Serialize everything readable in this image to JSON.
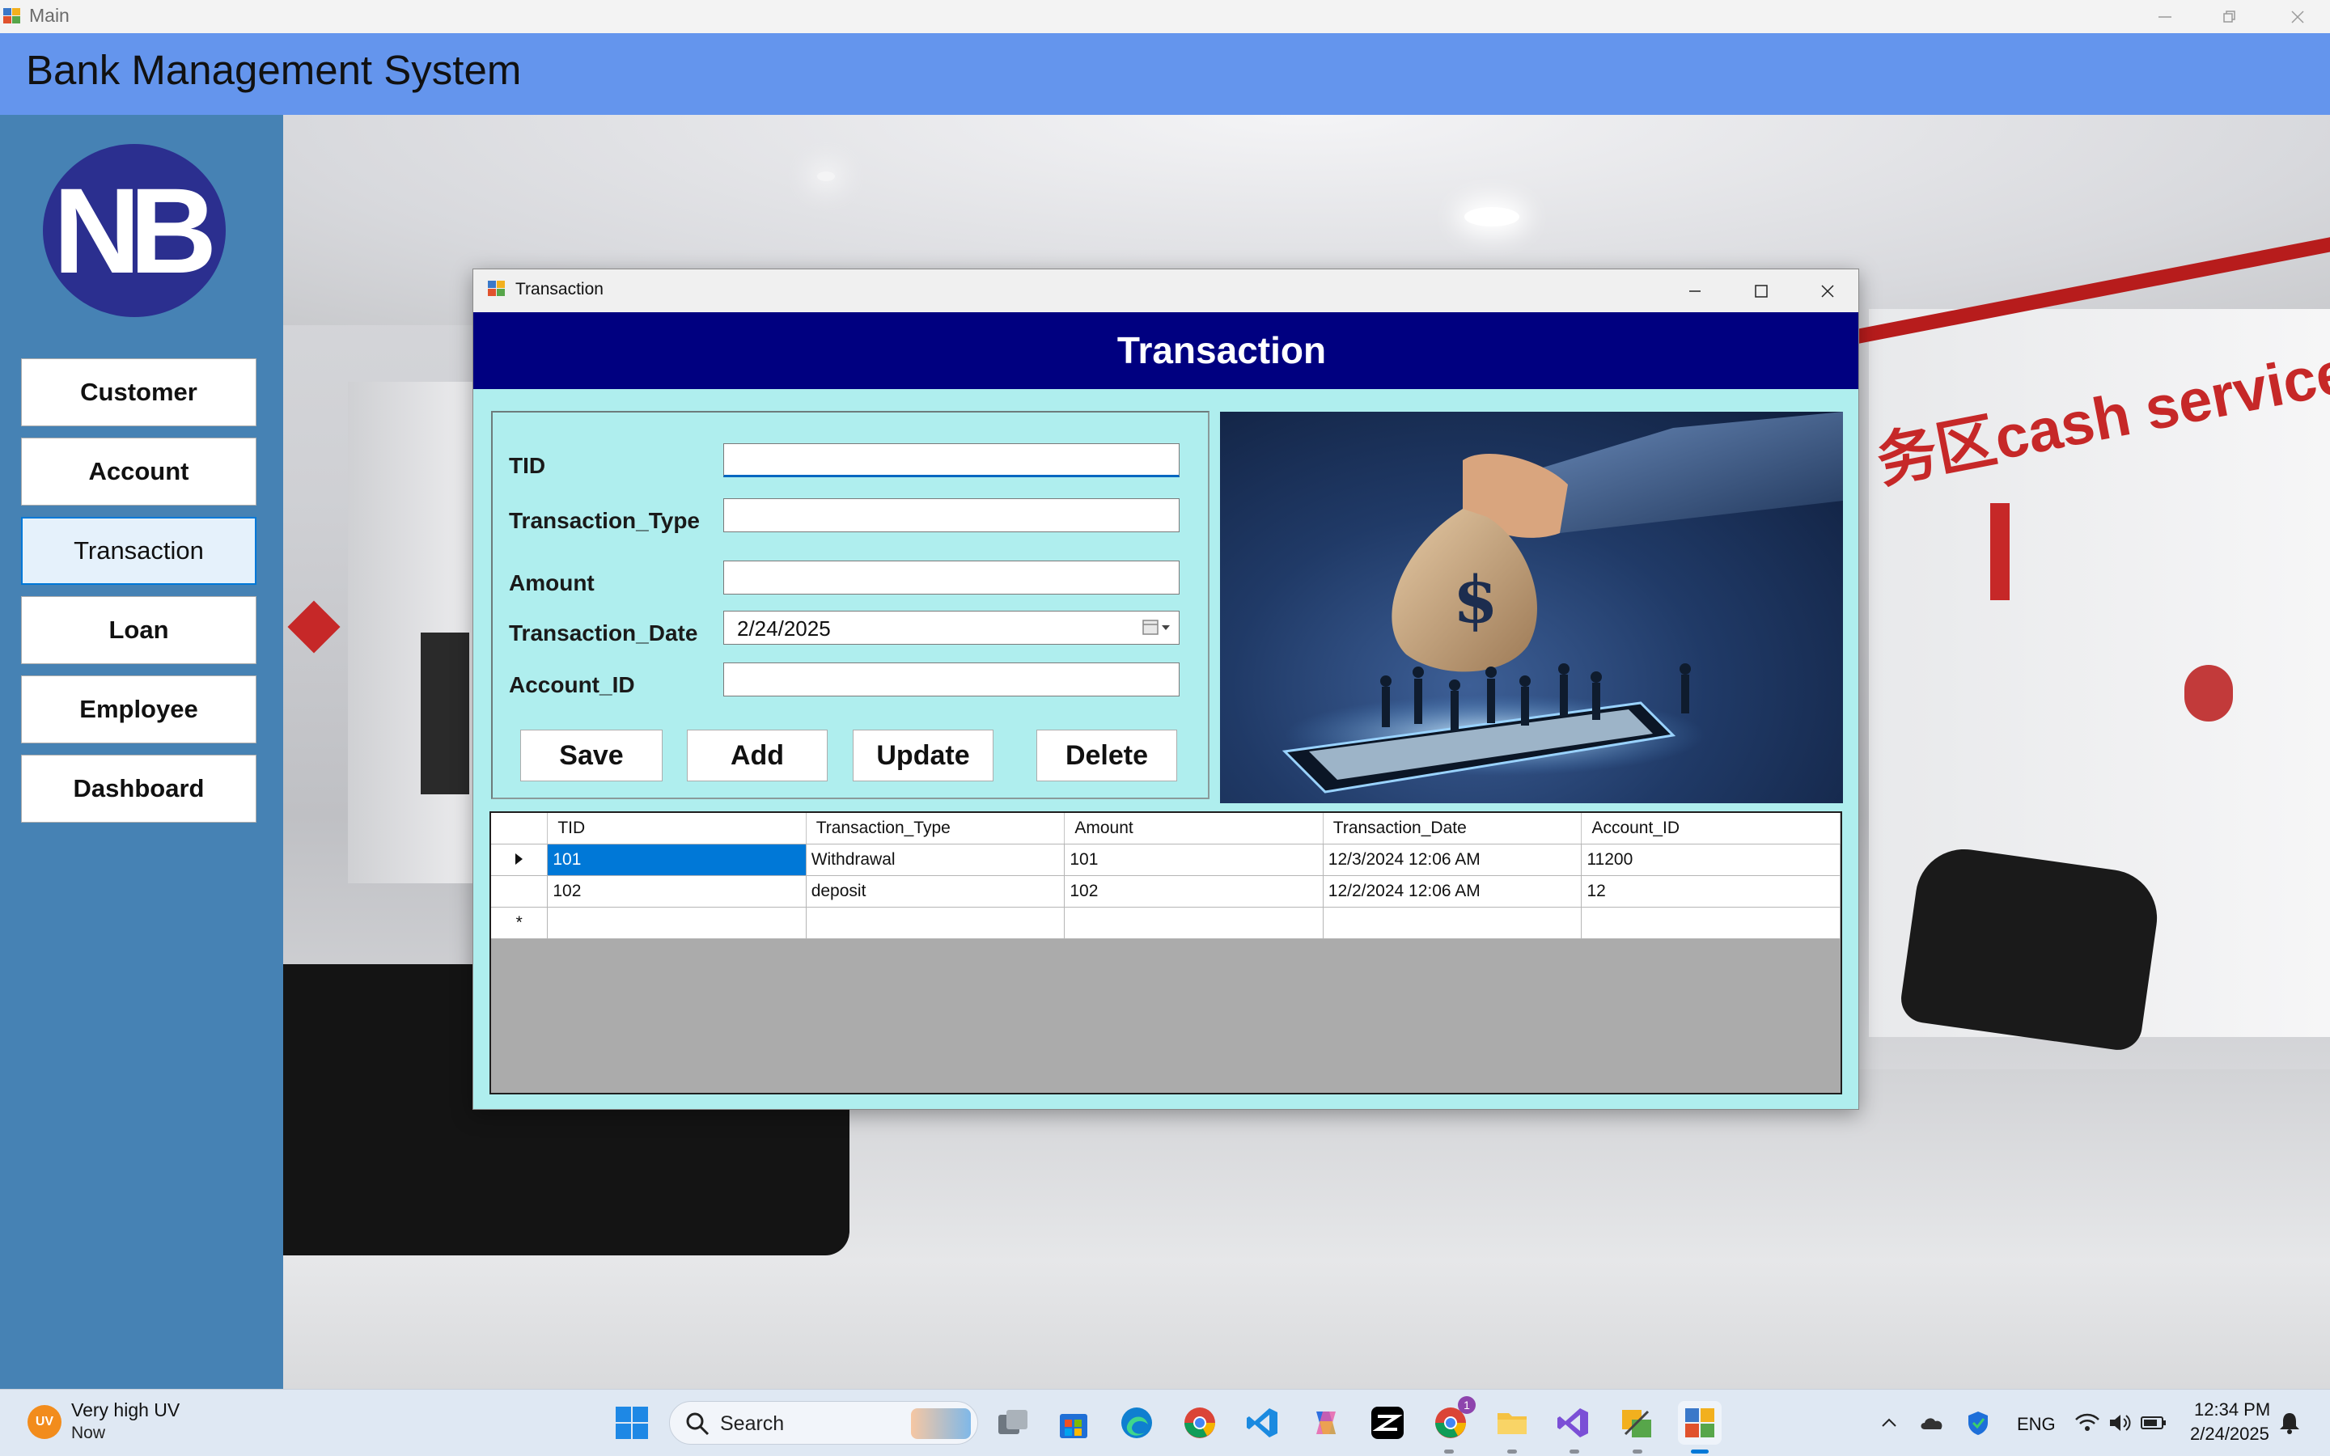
{
  "window": {
    "title": "Main"
  },
  "app": {
    "title": "Bank Management System",
    "logo_text": "NB"
  },
  "sidebar": {
    "items": [
      {
        "label": "Customer"
      },
      {
        "label": "Account"
      },
      {
        "label": "Transaction",
        "active": true
      },
      {
        "label": "Loan"
      },
      {
        "label": "Employee"
      },
      {
        "label": "Dashboard"
      }
    ]
  },
  "background": {
    "sign_text": "务区cash service"
  },
  "dialog": {
    "window_title": "Transaction",
    "header": "Transaction",
    "form": {
      "tid_label": "TID",
      "tid_value": "",
      "type_label": "Transaction_Type",
      "type_value": "",
      "amount_label": "Amount",
      "amount_value": "",
      "date_label": "Transaction_Date",
      "date_value": "2/24/2025",
      "account_label": "Account_ID",
      "account_value": ""
    },
    "buttons": {
      "save": "Save",
      "add": "Add",
      "update": "Update",
      "delete": "Delete"
    },
    "illustration": {
      "symbol": "$"
    },
    "grid": {
      "columns": [
        "TID",
        "Transaction_Type",
        "Amount",
        "Transaction_Date",
        "Account_ID"
      ],
      "rows": [
        [
          "101",
          "Withdrawal",
          "101",
          "12/3/2024 12:06 AM",
          "11200"
        ],
        [
          "102",
          "deposit",
          "102",
          "12/2/2024 12:06 AM",
          "12"
        ]
      ],
      "new_row_marker": "*"
    }
  },
  "taskbar": {
    "weather": {
      "badge": "UV",
      "title": "Very high UV",
      "subtitle": "Now"
    },
    "search_label": "Search",
    "language": "ENG",
    "time": "12:34 PM",
    "date": "2/24/2025",
    "notification_count": "1",
    "colors": {
      "accent": "#0078d7",
      "header_blue": "#6495ed",
      "sidebar_blue": "#4682b4",
      "dialog_bg": "#afeeee",
      "dialog_header": "#000080"
    }
  }
}
